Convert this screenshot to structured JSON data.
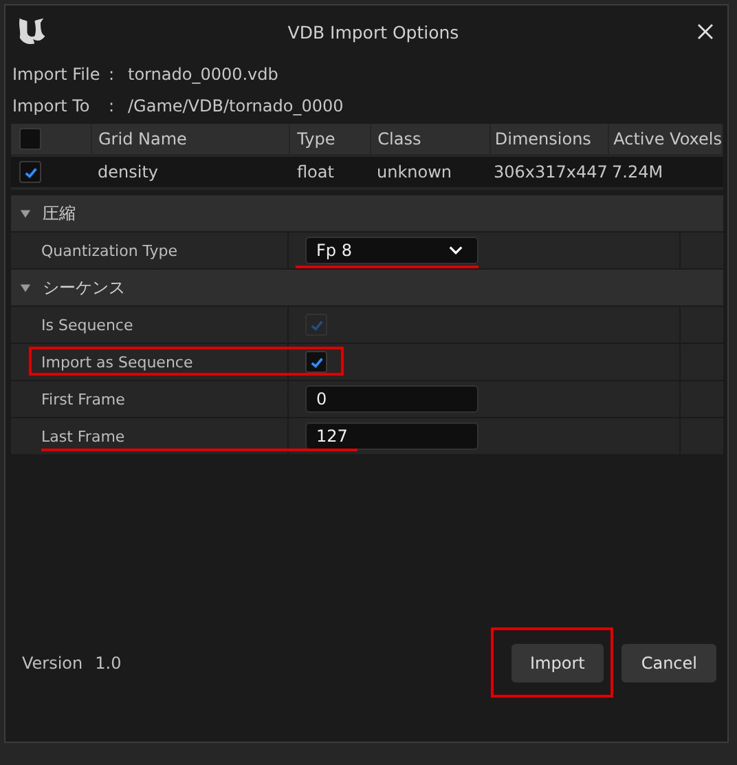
{
  "window": {
    "title": "VDB Import Options"
  },
  "info": [
    {
      "label": "Import File",
      "separator": ":",
      "value": "tornado_0000.vdb"
    },
    {
      "label": "Import To",
      "separator": ":",
      "value": "/Game/VDB/tornado_0000"
    }
  ],
  "grid_table": {
    "columns": [
      "Grid Name",
      "Type",
      "Class",
      "Dimensions",
      "Active Voxels"
    ],
    "all_checked": false,
    "rows": [
      {
        "checked": true,
        "cells": [
          "density",
          "float",
          "unknown",
          "306x317x447",
          "7.24M"
        ]
      }
    ]
  },
  "categories": [
    {
      "title": "圧縮",
      "expanded": true,
      "properties": [
        {
          "kind": "dropdown",
          "label": "Quantization Type",
          "value": "Fp 8",
          "boxed": false,
          "underlined": true
        }
      ]
    },
    {
      "title": "シーケンス",
      "expanded": true,
      "properties": [
        {
          "kind": "checkbox",
          "label": "Is Sequence",
          "checked": true,
          "disabled": true,
          "boxed": false,
          "underlined": false
        },
        {
          "kind": "checkbox",
          "label": "Import as Sequence",
          "checked": true,
          "disabled": false,
          "boxed": true,
          "underlined": false
        },
        {
          "kind": "number",
          "label": "First Frame",
          "value": "0",
          "boxed": false,
          "underlined": false
        },
        {
          "kind": "number",
          "label": "Last Frame",
          "value": "127",
          "boxed": false,
          "underlined": true
        }
      ]
    }
  ],
  "version": {
    "label": "Version",
    "value": "1.0"
  },
  "buttons": [
    {
      "label": "Import",
      "boxed": true
    },
    {
      "label": "Cancel",
      "boxed": false
    }
  ]
}
